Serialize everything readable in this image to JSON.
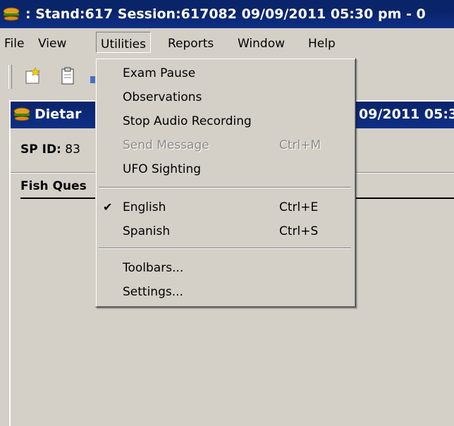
{
  "titlebar": {
    "title": ": Stand:617 Session:617082 09/09/2011 05:30 pm - 0"
  },
  "menubar": {
    "items": [
      "File",
      "View",
      "Utilities",
      "Reports",
      "Window",
      "Help"
    ]
  },
  "child": {
    "title": "Dietar",
    "title_right": "09/2011 05:3",
    "sp_label": "SP ID:",
    "sp_value": " 83",
    "tab_label": "Fish Ques"
  },
  "utilities_menu": {
    "items": [
      {
        "label": "Exam Pause",
        "shortcut": ""
      },
      {
        "label": "Observations",
        "shortcut": ""
      },
      {
        "label": "Stop Audio Recording",
        "shortcut": ""
      },
      {
        "label": "Send Message",
        "shortcut": "Ctrl+M",
        "disabled": true
      },
      {
        "label": "UFO Sighting",
        "shortcut": ""
      },
      {
        "label": "English",
        "shortcut": "Ctrl+E",
        "checked": true
      },
      {
        "label": "Spanish",
        "shortcut": "Ctrl+S"
      },
      {
        "label": "Toolbars...",
        "shortcut": ""
      },
      {
        "label": "Settings...",
        "shortcut": ""
      }
    ]
  },
  "icons": [
    "app-hamburger-icon",
    "new-document-icon",
    "clipboard-icon",
    "checkmark-icon"
  ],
  "colors": {
    "titlebar": "#0a246a",
    "face": "#d4d0c8",
    "disabled_text": "#8a8a8a"
  }
}
